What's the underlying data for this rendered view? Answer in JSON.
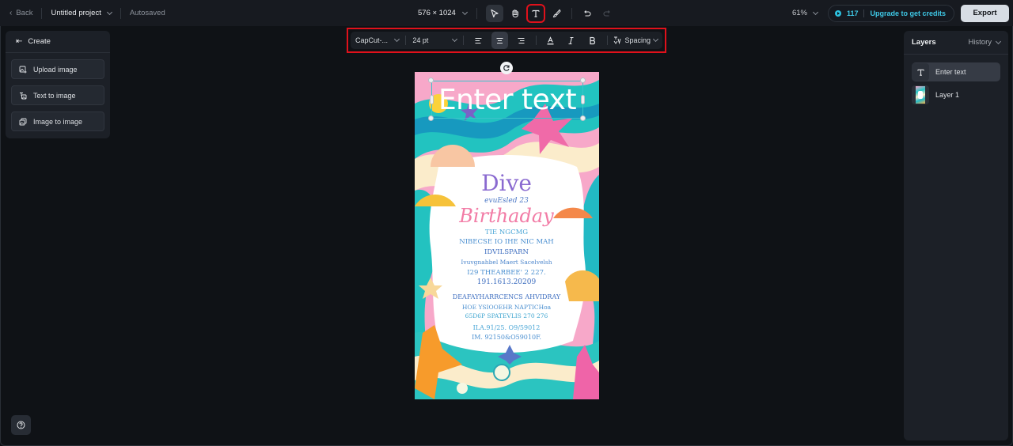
{
  "topbar": {
    "back_label": "Back",
    "project_title": "Untitled project",
    "status": "Autosaved",
    "canvas_size": "576 × 1024",
    "tools": [
      {
        "name": "select",
        "active": true
      },
      {
        "name": "hand",
        "active": false
      },
      {
        "name": "text",
        "active": false,
        "highlighted": true
      },
      {
        "name": "brush",
        "active": false
      },
      {
        "name": "undo",
        "enabled": true
      },
      {
        "name": "redo",
        "enabled": false
      }
    ],
    "zoom_level": "61%",
    "credits": "117",
    "upgrade_label": "Upgrade to get credits",
    "export_label": "Export"
  },
  "text_toolbar": {
    "font": "CapCut-...",
    "size": "24 pt",
    "align_options": [
      "left",
      "center",
      "right"
    ],
    "align_selected": "center",
    "spacing_label": "Spacing"
  },
  "left_panel": {
    "title": "Create",
    "buttons": [
      {
        "label": "Upload image",
        "icon": "upload-image-icon"
      },
      {
        "label": "Text to image",
        "icon": "text-to-image-icon"
      },
      {
        "label": "Image to image",
        "icon": "image-to-image-icon"
      }
    ]
  },
  "right_panel": {
    "title": "Layers",
    "history_label": "History",
    "layers": [
      {
        "label": "Enter text",
        "type": "text",
        "selected": true
      },
      {
        "label": "Layer 1",
        "type": "image",
        "selected": false
      }
    ]
  },
  "canvas": {
    "text_layer": "Enter text",
    "invite": {
      "title1": "Dive",
      "sub1": "evuEsled 23",
      "title2": "Birthaday",
      "lines": [
        "TIE NGCMG",
        "NIBECSE IO IHE NIC MAH",
        "IDVILSPARN",
        "Ivuvgnahbel Maert Sacelvelsh",
        "I29 THEARBEE' 2 227.",
        "191.1613.20209",
        "DEAFAYHARRCENCS AHVIDRAY",
        "HOE YSIOOEHR NAPTICHoa",
        "65D6P SPATEVLIS 270 276",
        "ILA.91/25. O9/59012",
        "IM. 92150&O59010F."
      ]
    }
  },
  "colors": {
    "accent": "#3ec8e6",
    "highlight_box": "#e0111b",
    "export_bg": "#d7dde4"
  }
}
